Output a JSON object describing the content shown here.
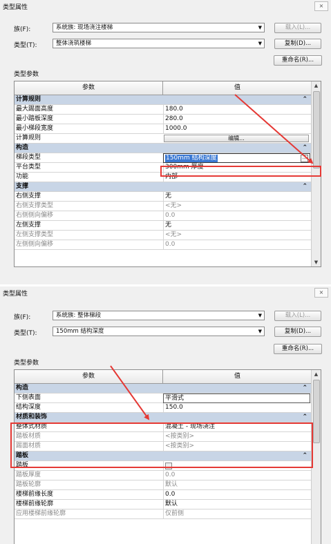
{
  "top": {
    "title": "类型属性",
    "close_icon": "×",
    "family_label": "族(F):",
    "family_value": "系统族: 现场浇注楼梯",
    "type_label": "类型(T):",
    "type_value": "整体浇筑楼梯",
    "load_label": "载入(L)...",
    "duplicate_label": "复制(D)...",
    "rename_label": "重命名(R)...",
    "params_label": "类型参数",
    "col_param": "参数",
    "col_value": "值",
    "rows": [
      {
        "k": "计算规则",
        "kind": "cat"
      },
      {
        "k": "最大踢面高度",
        "v": "180.0"
      },
      {
        "k": "最小踏板深度",
        "v": "280.0"
      },
      {
        "k": "最小梯段宽度",
        "v": "1000.0"
      },
      {
        "k": "计算规则",
        "v": "编辑...",
        "kind": "button"
      },
      {
        "k": "构造",
        "kind": "cat"
      },
      {
        "k": "梯段类型",
        "v": "150mm 结构深度",
        "kind": "selected"
      },
      {
        "k": "平台类型",
        "v": "300mm 厚度"
      },
      {
        "k": "功能",
        "v": "内部"
      },
      {
        "k": "支撑",
        "kind": "cat"
      },
      {
        "k": "右侧支撑",
        "v": "无"
      },
      {
        "k": "右侧支撑类型",
        "v": "<无>",
        "kind": "dis"
      },
      {
        "k": "右侧侧向偏移",
        "v": "0.0",
        "kind": "dis"
      },
      {
        "k": "左侧支撑",
        "v": "无"
      },
      {
        "k": "左侧支撑类型",
        "v": "<无>",
        "kind": "dis"
      },
      {
        "k": "左侧侧向偏移",
        "v": "0.0",
        "kind": "dis"
      }
    ]
  },
  "bottom": {
    "title": "类型属性",
    "close_icon": "×",
    "family_label": "族(F):",
    "family_value": "系统族: 整体梯段",
    "type_label": "类型(T):",
    "type_value": "150mm 结构深度",
    "load_label": "载入(L)...",
    "duplicate_label": "复制(D)...",
    "rename_label": "重命名(R)...",
    "params_label": "类型参数",
    "col_param": "参数",
    "col_value": "值",
    "rows": [
      {
        "k": "构造",
        "kind": "cat"
      },
      {
        "k": "下侧表面",
        "v": "平滑式",
        "kind": "boxed"
      },
      {
        "k": "结构深度",
        "v": "150.0"
      },
      {
        "k": "材质和装饰",
        "kind": "cat"
      },
      {
        "k": "整体式材质",
        "v": "混凝土 - 现场浇注"
      },
      {
        "k": "踏板材质",
        "v": "<按类别>",
        "kind": "dis"
      },
      {
        "k": "踢面材质",
        "v": "<按类别>",
        "kind": "dis"
      },
      {
        "k": "踏板",
        "kind": "cat"
      },
      {
        "k": "踏板",
        "v": "",
        "kind": "check"
      },
      {
        "k": "踏板厚度",
        "v": "0.0",
        "kind": "dis"
      },
      {
        "k": "踏板轮廓",
        "v": "默认",
        "kind": "dis"
      },
      {
        "k": "楼梯前缘长度",
        "v": "0.0"
      },
      {
        "k": "楼梯前缘轮廓",
        "v": "默认"
      },
      {
        "k": "应用楼梯前缘轮廓",
        "v": "仅前侧",
        "kind": "dis"
      }
    ]
  },
  "icons": {
    "dropdown": "chevron-down-icon",
    "collapse": "chevron-up-icon",
    "ellipsis": "ellipsis-icon"
  },
  "colors": {
    "category_row": "#c8d5e6",
    "selection": "#3b79d3",
    "annotation_red": "#e53935"
  }
}
